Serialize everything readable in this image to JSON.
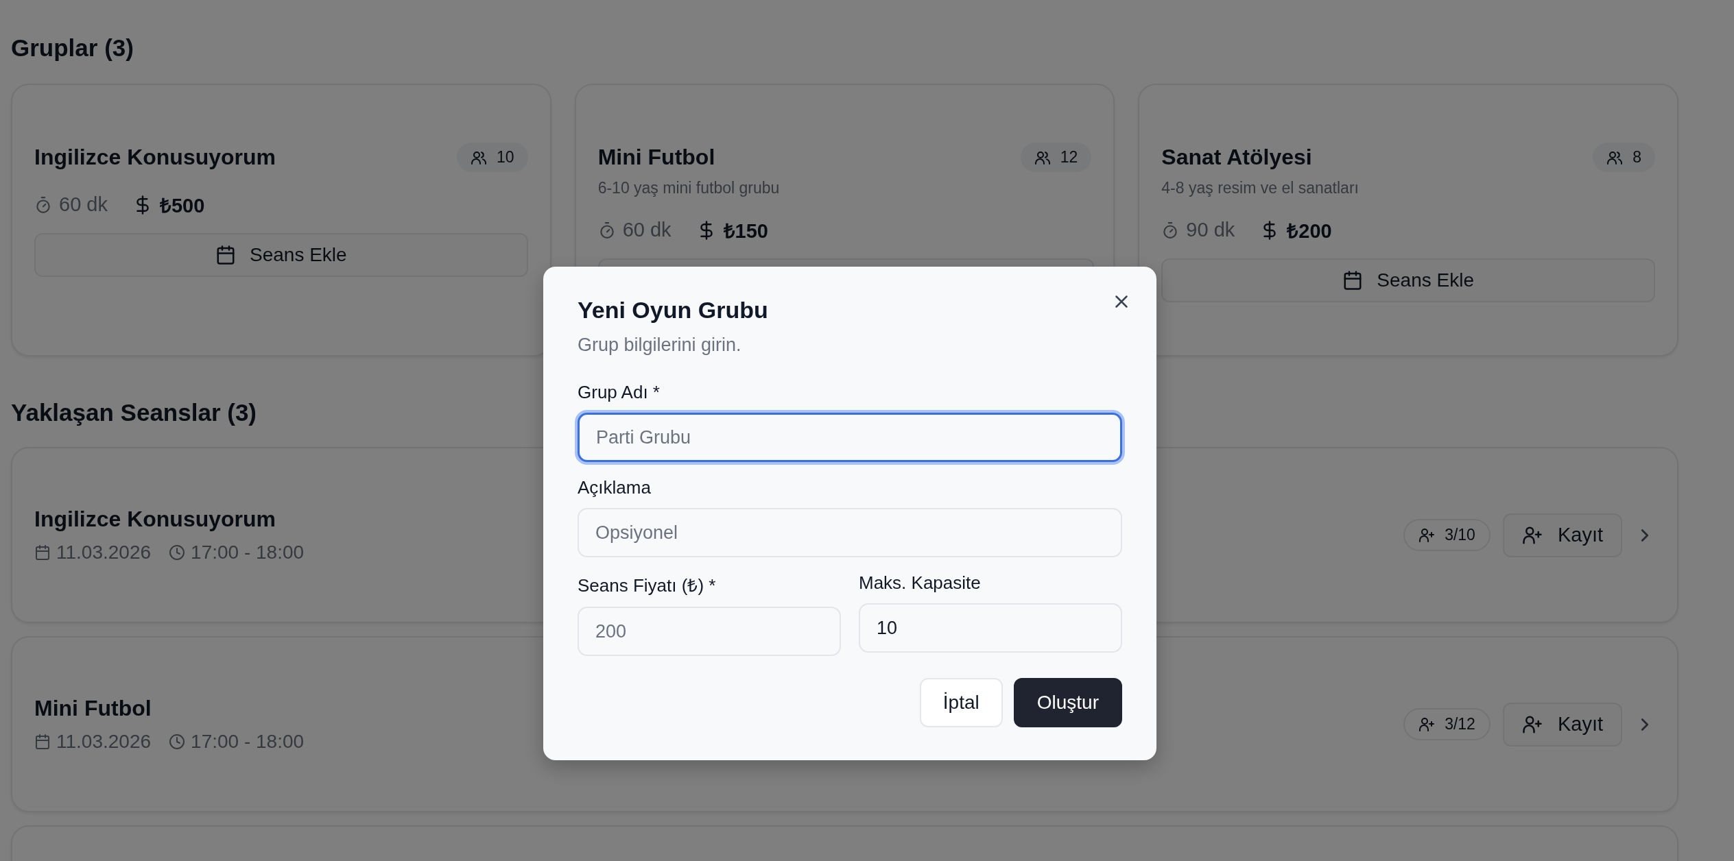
{
  "groups_heading": "Gruplar (3)",
  "groups": [
    {
      "name": "Ingilizce Konusuyorum",
      "capacity": "10",
      "duration": "60 dk",
      "price": "₺500",
      "action": "Seans Ekle"
    },
    {
      "name": "Mini Futbol",
      "description": "6-10 yaş mini futbol grubu",
      "capacity": "12",
      "duration": "60 dk",
      "price": "₺150"
    },
    {
      "name": "Sanat Atölyesi",
      "description": "4-8 yaş resim ve el sanatları",
      "capacity": "8",
      "duration": "90 dk",
      "price": "₺200",
      "action": "Seans Ekle"
    }
  ],
  "sessions_heading": "Yaklaşan Seanslar (3)",
  "sessions": [
    {
      "name": "Ingilizce Konusuyorum",
      "date": "11.03.2026",
      "time": "17:00 - 18:00",
      "enrolled": "3/10",
      "action": "Kayıt"
    },
    {
      "name": "Mini Futbol",
      "date": "11.03.2026",
      "time": "17:00 - 18:00",
      "enrolled": "3/12",
      "action": "Kayıt"
    }
  ],
  "dialog": {
    "title": "Yeni Oyun Grubu",
    "description": "Grup bilgilerini girin.",
    "rows": [
      [
        {
          "label": "Grup Adı *",
          "placeholder": "Parti Grubu",
          "focused": true
        }
      ],
      [
        {
          "label": "Açıklama",
          "placeholder": "Opsiyonel",
          "focused": false
        }
      ],
      [
        {
          "label": "Seans Fiyatı (₺) *",
          "placeholder": "200",
          "focused": false
        },
        {
          "label": "Maks. Kapasite",
          "value": "10",
          "focused": false
        }
      ]
    ],
    "buttons": [
      {
        "label": "İptal",
        "kind": "secondary"
      },
      {
        "label": "Oluştur",
        "kind": "primary"
      }
    ]
  }
}
